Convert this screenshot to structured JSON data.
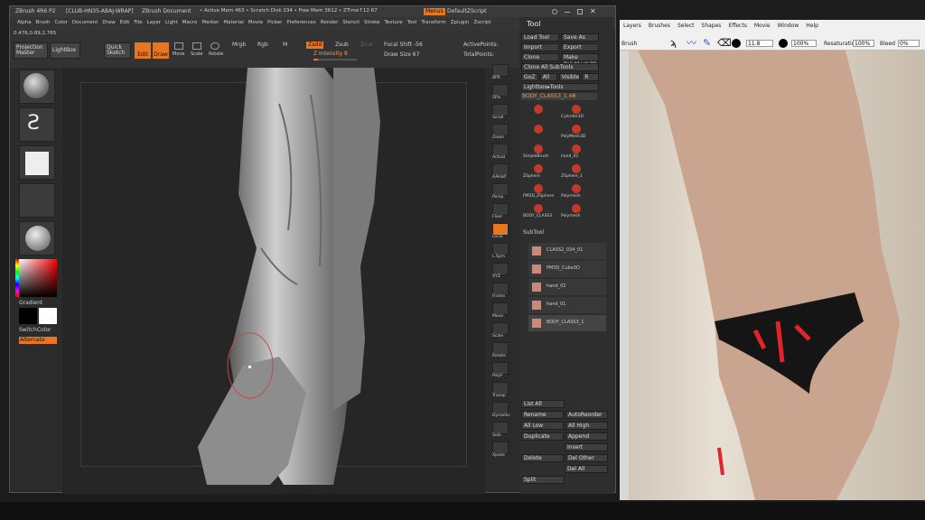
{
  "zbrush": {
    "titlebar": {
      "app": "ZBrush 4R6 P2",
      "doc_name": "[CLUB-HN35-ABAJ-WRAP]",
      "doc_label": "ZBrush Document",
      "stats": "• Active Mem 463 • Scratch Disk 234 • Free Mem 3612 • ZTime↑12.67",
      "menus_btn": "Menus",
      "script_btn": "DefaultZScript"
    },
    "menu": [
      "Alpha",
      "Brush",
      "Color",
      "Document",
      "Draw",
      "Edit",
      "File",
      "Layer",
      "Light",
      "Macro",
      "Marker",
      "Material",
      "Movie",
      "Picker",
      "Preferences",
      "Render",
      "Stencil",
      "Stroke",
      "Texture",
      "Tool",
      "Transform",
      "Zplugin",
      "Zscript"
    ],
    "toolbar": {
      "coords": "0.476,0.89,2.765",
      "projection_master": "Projection Master",
      "lightbox": "LightBox",
      "quick_sketch": "Quick Sketch",
      "edit": "Edit",
      "draw": "Draw",
      "move": "Move",
      "scale": "Scale",
      "rotate": "Rotate",
      "mrgb": "Mrgb",
      "rgb": "Rgb",
      "m": "M",
      "zadd": "Zadd",
      "zsub": "Zsub",
      "zcut": "Zcut",
      "z_intensity": "Z Intensity 8",
      "focal_shift": "Focal Shift -56",
      "draw_size": "Draw Size 67",
      "active_points": "ActivePoints:",
      "total_points": "TotalPoints:"
    },
    "leftshelf": {
      "gradient": "Gradient",
      "switch_color": "SwitchColor",
      "alternate": "Alternate"
    },
    "rightshelf": [
      "BPR",
      "SPix",
      "Scroll",
      "Zoom",
      "Actual",
      "AAHalf",
      "Persp",
      "Floor",
      "Local",
      "L.Sym",
      "XYZ",
      "Frame",
      "Move",
      "Scale",
      "Rotate",
      "PolyF",
      "Transp",
      "Dynamic",
      "Solo",
      "Xpose"
    ],
    "tool": {
      "title": "Tool",
      "rows": [
        [
          "Load Tool",
          "Save As"
        ],
        [
          "Import",
          "Export"
        ],
        [
          "Clone",
          "Make PolyMesh3D"
        ],
        [
          "Clone All SubTools"
        ],
        [
          "GoZ",
          "All",
          "Visible",
          "R"
        ],
        [
          "Lightbox▸Tools"
        ]
      ],
      "current": "BODY_CLASS3_1.48",
      "grid": [
        "",
        "Cylinder3D",
        "",
        "PolyMesh3D",
        "SimpleBrush",
        "hand_02",
        "ZSphere",
        "ZSphere_1",
        "PM3D_ZSphere",
        "Polymesh",
        "BODY_CLASS3",
        "Polymesh"
      ],
      "subtool_title": "SubTool",
      "subtools": [
        "CLASS2_034_01",
        "PM3D_Cube3D",
        "hand_02",
        "hand_01",
        "BODY_CLASS3_1"
      ],
      "bottom": [
        [
          "List All",
          ""
        ],
        [
          "Rename",
          "AutoReorder"
        ],
        [
          "All Low",
          "All High"
        ],
        [
          "Duplicate",
          "Append"
        ],
        [
          "",
          "Insert"
        ],
        [
          "Delete",
          "Del Other"
        ],
        [
          "",
          "Del All"
        ],
        [
          "Split",
          ""
        ]
      ]
    }
  },
  "reference": {
    "title": "Brush",
    "menu": [
      "Layers",
      "Brushes",
      "Select",
      "Shapes",
      "Effects",
      "Movie",
      "Window",
      "Help"
    ],
    "brush_size": "11.8",
    "opacity": "100%",
    "resaturation_label": "Resaturation",
    "resaturation": "100%",
    "bleed_label": "Bleed",
    "bleed": "0%"
  }
}
